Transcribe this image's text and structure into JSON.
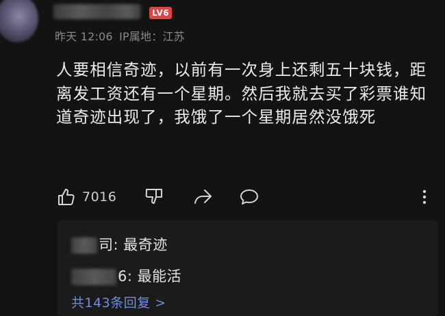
{
  "comment": {
    "level_badge": "LV6",
    "time": "昨天 12:06",
    "ip_location": "IP属地：江苏",
    "text": "人要相信奇迹，以前有一次身上还剩五十块钱，距离发工资还有一个星期。然后我就去买了彩票谁知道奇迹出现了，我饿了一个星期居然没饿死",
    "likes": "7016"
  },
  "replies": [
    {
      "name_visible_suffix": "司",
      "text": "最奇迹"
    },
    {
      "name_visible_suffix": "6:",
      "text": "最能活"
    }
  ],
  "replies_total": "共143条回复 >",
  "icons": {
    "like": "thumbs-up-icon",
    "dislike": "thumbs-down-icon",
    "share": "share-icon",
    "reply": "comment-bubble-icon",
    "more": "more-vertical-icon"
  },
  "colors": {
    "background": "#131313",
    "badge": "#e04343",
    "link": "#6f8fd8"
  }
}
